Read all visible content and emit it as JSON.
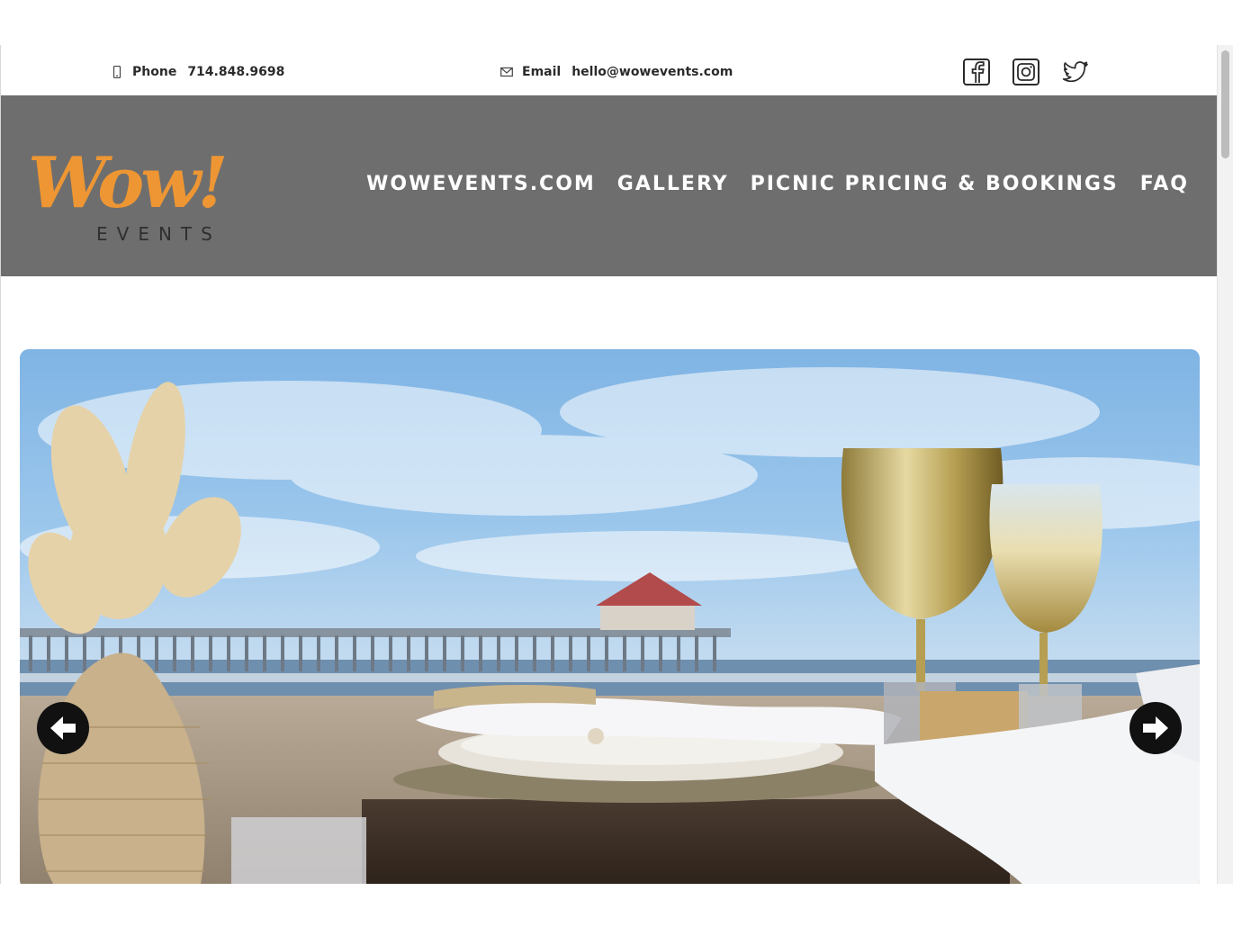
{
  "topbar": {
    "phone_label": "Phone",
    "phone_value": "714.848.9698",
    "email_label": "Email",
    "email_value": "hello@wowevents.com",
    "social": [
      "facebook-icon",
      "instagram-icon",
      "twitter-icon"
    ]
  },
  "brand": {
    "logo_script": "Wow!",
    "logo_sub": "EVENTS",
    "accent": "#EE9633",
    "nav_bg": "#6E6E6E"
  },
  "nav": {
    "items": [
      "WOWEVENTS.COM",
      "GALLERY",
      "PICNIC PRICING & BOOKINGS",
      "FAQ"
    ]
  },
  "hero": {
    "prev_icon": "arrow-left-icon",
    "next_icon": "arrow-right-icon"
  }
}
